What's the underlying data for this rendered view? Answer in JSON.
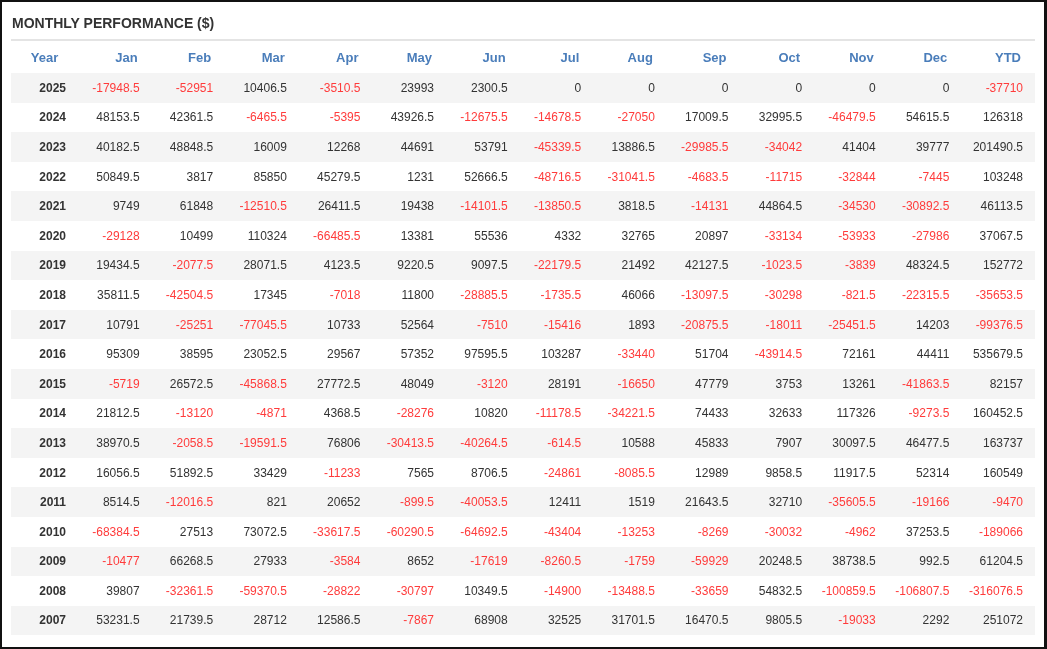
{
  "title": "MONTHLY PERFORMANCE ($)",
  "columns": [
    "Year",
    "Jan",
    "Feb",
    "Mar",
    "Apr",
    "May",
    "Jun",
    "Jul",
    "Aug",
    "Sep",
    "Oct",
    "Nov",
    "Dec",
    "YTD"
  ],
  "rows": [
    {
      "year": "2025",
      "cells": [
        {
          "text": "-17948.5",
          "negative": true
        },
        {
          "text": "-52951",
          "negative": true
        },
        {
          "text": "10406.5",
          "negative": false
        },
        {
          "text": "-3510.5",
          "negative": true
        },
        {
          "text": "23993",
          "negative": false
        },
        {
          "text": "2300.5",
          "negative": false
        },
        {
          "text": "0",
          "negative": false
        },
        {
          "text": "0",
          "negative": false
        },
        {
          "text": "0",
          "negative": false
        },
        {
          "text": "0",
          "negative": false
        },
        {
          "text": "0",
          "negative": false
        },
        {
          "text": "0",
          "negative": false
        },
        {
          "text": "-37710",
          "negative": true
        }
      ]
    },
    {
      "year": "2024",
      "cells": [
        {
          "text": "48153.5",
          "negative": false
        },
        {
          "text": "42361.5",
          "negative": false
        },
        {
          "text": "-6465.5",
          "negative": true
        },
        {
          "text": "-5395",
          "negative": true
        },
        {
          "text": "43926.5",
          "negative": false
        },
        {
          "text": "-12675.5",
          "negative": true
        },
        {
          "text": "-14678.5",
          "negative": true
        },
        {
          "text": "-27050",
          "negative": true
        },
        {
          "text": "17009.5",
          "negative": false
        },
        {
          "text": "32995.5",
          "negative": false
        },
        {
          "text": "-46479.5",
          "negative": true
        },
        {
          "text": "54615.5",
          "negative": false
        },
        {
          "text": "126318",
          "negative": false
        }
      ]
    },
    {
      "year": "2023",
      "cells": [
        {
          "text": "40182.5",
          "negative": false
        },
        {
          "text": "48848.5",
          "negative": false
        },
        {
          "text": "16009",
          "negative": false
        },
        {
          "text": "12268",
          "negative": false
        },
        {
          "text": "44691",
          "negative": false
        },
        {
          "text": "53791",
          "negative": false
        },
        {
          "text": "-45339.5",
          "negative": true
        },
        {
          "text": "13886.5",
          "negative": false
        },
        {
          "text": "-29985.5",
          "negative": true
        },
        {
          "text": "-34042",
          "negative": true
        },
        {
          "text": "41404",
          "negative": false
        },
        {
          "text": "39777",
          "negative": false
        },
        {
          "text": "201490.5",
          "negative": false
        }
      ]
    },
    {
      "year": "2022",
      "cells": [
        {
          "text": "50849.5",
          "negative": false
        },
        {
          "text": "3817",
          "negative": false
        },
        {
          "text": "85850",
          "negative": false
        },
        {
          "text": "45279.5",
          "negative": false
        },
        {
          "text": "1231",
          "negative": false
        },
        {
          "text": "52666.5",
          "negative": false
        },
        {
          "text": "-48716.5",
          "negative": true
        },
        {
          "text": "-31041.5",
          "negative": true
        },
        {
          "text": "-4683.5",
          "negative": true
        },
        {
          "text": "-11715",
          "negative": true
        },
        {
          "text": "-32844",
          "negative": true
        },
        {
          "text": "-7445",
          "negative": true
        },
        {
          "text": "103248",
          "negative": false
        }
      ]
    },
    {
      "year": "2021",
      "cells": [
        {
          "text": "9749",
          "negative": false
        },
        {
          "text": "61848",
          "negative": false
        },
        {
          "text": "-12510.5",
          "negative": true
        },
        {
          "text": "26411.5",
          "negative": false
        },
        {
          "text": "19438",
          "negative": false
        },
        {
          "text": "-14101.5",
          "negative": true
        },
        {
          "text": "-13850.5",
          "negative": true
        },
        {
          "text": "3818.5",
          "negative": false
        },
        {
          "text": "-14131",
          "negative": true
        },
        {
          "text": "44864.5",
          "negative": false
        },
        {
          "text": "-34530",
          "negative": true
        },
        {
          "text": "-30892.5",
          "negative": true
        },
        {
          "text": "46113.5",
          "negative": false
        }
      ]
    },
    {
      "year": "2020",
      "cells": [
        {
          "text": "-29128",
          "negative": true
        },
        {
          "text": "10499",
          "negative": false
        },
        {
          "text": "110324",
          "negative": false
        },
        {
          "text": "-66485.5",
          "negative": true
        },
        {
          "text": "13381",
          "negative": false
        },
        {
          "text": "55536",
          "negative": false
        },
        {
          "text": "4332",
          "negative": false
        },
        {
          "text": "32765",
          "negative": false
        },
        {
          "text": "20897",
          "negative": false
        },
        {
          "text": "-33134",
          "negative": true
        },
        {
          "text": "-53933",
          "negative": true
        },
        {
          "text": "-27986",
          "negative": true
        },
        {
          "text": "37067.5",
          "negative": false
        }
      ]
    },
    {
      "year": "2019",
      "cells": [
        {
          "text": "19434.5",
          "negative": false
        },
        {
          "text": "-2077.5",
          "negative": true
        },
        {
          "text": "28071.5",
          "negative": false
        },
        {
          "text": "4123.5",
          "negative": false
        },
        {
          "text": "9220.5",
          "negative": false
        },
        {
          "text": "9097.5",
          "negative": false
        },
        {
          "text": "-22179.5",
          "negative": true
        },
        {
          "text": "21492",
          "negative": false
        },
        {
          "text": "42127.5",
          "negative": false
        },
        {
          "text": "-1023.5",
          "negative": true
        },
        {
          "text": "-3839",
          "negative": true
        },
        {
          "text": "48324.5",
          "negative": false
        },
        {
          "text": "152772",
          "negative": false
        }
      ]
    },
    {
      "year": "2018",
      "cells": [
        {
          "text": "35811.5",
          "negative": false
        },
        {
          "text": "-42504.5",
          "negative": true
        },
        {
          "text": "17345",
          "negative": false
        },
        {
          "text": "-7018",
          "negative": true
        },
        {
          "text": "11800",
          "negative": false
        },
        {
          "text": "-28885.5",
          "negative": true
        },
        {
          "text": "-1735.5",
          "negative": true
        },
        {
          "text": "46066",
          "negative": false
        },
        {
          "text": "-13097.5",
          "negative": true
        },
        {
          "text": "-30298",
          "negative": true
        },
        {
          "text": "-821.5",
          "negative": true
        },
        {
          "text": "-22315.5",
          "negative": true
        },
        {
          "text": "-35653.5",
          "negative": true
        }
      ]
    },
    {
      "year": "2017",
      "cells": [
        {
          "text": "10791",
          "negative": false
        },
        {
          "text": "-25251",
          "negative": true
        },
        {
          "text": "-77045.5",
          "negative": true
        },
        {
          "text": "10733",
          "negative": false
        },
        {
          "text": "52564",
          "negative": false
        },
        {
          "text": "-7510",
          "negative": true
        },
        {
          "text": "-15416",
          "negative": true
        },
        {
          "text": "1893",
          "negative": false
        },
        {
          "text": "-20875.5",
          "negative": true
        },
        {
          "text": "-18011",
          "negative": true
        },
        {
          "text": "-25451.5",
          "negative": true
        },
        {
          "text": "14203",
          "negative": false
        },
        {
          "text": "-99376.5",
          "negative": true
        }
      ]
    },
    {
      "year": "2016",
      "cells": [
        {
          "text": "95309",
          "negative": false
        },
        {
          "text": "38595",
          "negative": false
        },
        {
          "text": "23052.5",
          "negative": false
        },
        {
          "text": "29567",
          "negative": false
        },
        {
          "text": "57352",
          "negative": false
        },
        {
          "text": "97595.5",
          "negative": false
        },
        {
          "text": "103287",
          "negative": false
        },
        {
          "text": "-33440",
          "negative": true
        },
        {
          "text": "51704",
          "negative": false
        },
        {
          "text": "-43914.5",
          "negative": true
        },
        {
          "text": "72161",
          "negative": false
        },
        {
          "text": "44411",
          "negative": false
        },
        {
          "text": "535679.5",
          "negative": false
        }
      ]
    },
    {
      "year": "2015",
      "cells": [
        {
          "text": "-5719",
          "negative": true
        },
        {
          "text": "26572.5",
          "negative": false
        },
        {
          "text": "-45868.5",
          "negative": true
        },
        {
          "text": "27772.5",
          "negative": false
        },
        {
          "text": "48049",
          "negative": false
        },
        {
          "text": "-3120",
          "negative": true
        },
        {
          "text": "28191",
          "negative": false
        },
        {
          "text": "-16650",
          "negative": true
        },
        {
          "text": "47779",
          "negative": false
        },
        {
          "text": "3753",
          "negative": false
        },
        {
          "text": "13261",
          "negative": false
        },
        {
          "text": "-41863.5",
          "negative": true
        },
        {
          "text": "82157",
          "negative": false
        }
      ]
    },
    {
      "year": "2014",
      "cells": [
        {
          "text": "21812.5",
          "negative": false
        },
        {
          "text": "-13120",
          "negative": true
        },
        {
          "text": "-4871",
          "negative": true
        },
        {
          "text": "4368.5",
          "negative": false
        },
        {
          "text": "-28276",
          "negative": true
        },
        {
          "text": "10820",
          "negative": false
        },
        {
          "text": "-11178.5",
          "negative": true
        },
        {
          "text": "-34221.5",
          "negative": true
        },
        {
          "text": "74433",
          "negative": false
        },
        {
          "text": "32633",
          "negative": false
        },
        {
          "text": "117326",
          "negative": false
        },
        {
          "text": "-9273.5",
          "negative": true
        },
        {
          "text": "160452.5",
          "negative": false
        }
      ]
    },
    {
      "year": "2013",
      "cells": [
        {
          "text": "38970.5",
          "negative": false
        },
        {
          "text": "-2058.5",
          "negative": true
        },
        {
          "text": "-19591.5",
          "negative": true
        },
        {
          "text": "76806",
          "negative": false
        },
        {
          "text": "-30413.5",
          "negative": true
        },
        {
          "text": "-40264.5",
          "negative": true
        },
        {
          "text": "-614.5",
          "negative": true
        },
        {
          "text": "10588",
          "negative": false
        },
        {
          "text": "45833",
          "negative": false
        },
        {
          "text": "7907",
          "negative": false
        },
        {
          "text": "30097.5",
          "negative": false
        },
        {
          "text": "46477.5",
          "negative": false
        },
        {
          "text": "163737",
          "negative": false
        }
      ]
    },
    {
      "year": "2012",
      "cells": [
        {
          "text": "16056.5",
          "negative": false
        },
        {
          "text": "51892.5",
          "negative": false
        },
        {
          "text": "33429",
          "negative": false
        },
        {
          "text": "-11233",
          "negative": true
        },
        {
          "text": "7565",
          "negative": false
        },
        {
          "text": "8706.5",
          "negative": false
        },
        {
          "text": "-24861",
          "negative": true
        },
        {
          "text": "-8085.5",
          "negative": true
        },
        {
          "text": "12989",
          "negative": false
        },
        {
          "text": "9858.5",
          "negative": false
        },
        {
          "text": "11917.5",
          "negative": false
        },
        {
          "text": "52314",
          "negative": false
        },
        {
          "text": "160549",
          "negative": false
        }
      ]
    },
    {
      "year": "2011",
      "cells": [
        {
          "text": "8514.5",
          "negative": false
        },
        {
          "text": "-12016.5",
          "negative": true
        },
        {
          "text": "821",
          "negative": false
        },
        {
          "text": "20652",
          "negative": false
        },
        {
          "text": "-899.5",
          "negative": true
        },
        {
          "text": "-40053.5",
          "negative": true
        },
        {
          "text": "12411",
          "negative": false
        },
        {
          "text": "1519",
          "negative": false
        },
        {
          "text": "21643.5",
          "negative": false
        },
        {
          "text": "32710",
          "negative": false
        },
        {
          "text": "-35605.5",
          "negative": true
        },
        {
          "text": "-19166",
          "negative": true
        },
        {
          "text": "-9470",
          "negative": true
        }
      ]
    },
    {
      "year": "2010",
      "cells": [
        {
          "text": "-68384.5",
          "negative": true
        },
        {
          "text": "27513",
          "negative": false
        },
        {
          "text": "73072.5",
          "negative": false
        },
        {
          "text": "-33617.5",
          "negative": true
        },
        {
          "text": "-60290.5",
          "negative": true
        },
        {
          "text": "-64692.5",
          "negative": true
        },
        {
          "text": "-43404",
          "negative": true
        },
        {
          "text": "-13253",
          "negative": true
        },
        {
          "text": "-8269",
          "negative": true
        },
        {
          "text": "-30032",
          "negative": true
        },
        {
          "text": "-4962",
          "negative": true
        },
        {
          "text": "37253.5",
          "negative": false
        },
        {
          "text": "-189066",
          "negative": true
        }
      ]
    },
    {
      "year": "2009",
      "cells": [
        {
          "text": "-10477",
          "negative": true
        },
        {
          "text": "66268.5",
          "negative": false
        },
        {
          "text": "27933",
          "negative": false
        },
        {
          "text": "-3584",
          "negative": true
        },
        {
          "text": "8652",
          "negative": false
        },
        {
          "text": "-17619",
          "negative": true
        },
        {
          "text": "-8260.5",
          "negative": true
        },
        {
          "text": "-1759",
          "negative": true
        },
        {
          "text": "-59929",
          "negative": true
        },
        {
          "text": "20248.5",
          "negative": false
        },
        {
          "text": "38738.5",
          "negative": false
        },
        {
          "text": "992.5",
          "negative": false
        },
        {
          "text": "61204.5",
          "negative": false
        }
      ]
    },
    {
      "year": "2008",
      "cells": [
        {
          "text": "39807",
          "negative": false
        },
        {
          "text": "-32361.5",
          "negative": true
        },
        {
          "text": "-59370.5",
          "negative": true
        },
        {
          "text": "-28822",
          "negative": true
        },
        {
          "text": "-30797",
          "negative": true
        },
        {
          "text": "10349.5",
          "negative": false
        },
        {
          "text": "-14900",
          "negative": true
        },
        {
          "text": "-13488.5",
          "negative": true
        },
        {
          "text": "-33659",
          "negative": true
        },
        {
          "text": "54832.5",
          "negative": false
        },
        {
          "text": "-100859.5",
          "negative": true
        },
        {
          "text": "-106807.5",
          "negative": true
        },
        {
          "text": "-316076.5",
          "negative": true
        }
      ]
    },
    {
      "year": "2007",
      "cells": [
        {
          "text": "53231.5",
          "negative": false
        },
        {
          "text": "21739.5",
          "negative": false
        },
        {
          "text": "28712",
          "negative": false
        },
        {
          "text": "12586.5",
          "negative": false
        },
        {
          "text": "-7867",
          "negative": true
        },
        {
          "text": "68908",
          "negative": false
        },
        {
          "text": "32525",
          "negative": false
        },
        {
          "text": "31701.5",
          "negative": false
        },
        {
          "text": "16470.5",
          "negative": false
        },
        {
          "text": "9805.5",
          "negative": false
        },
        {
          "text": "-19033",
          "negative": true
        },
        {
          "text": "2292",
          "negative": false
        },
        {
          "text": "251072",
          "negative": false
        }
      ]
    }
  ]
}
